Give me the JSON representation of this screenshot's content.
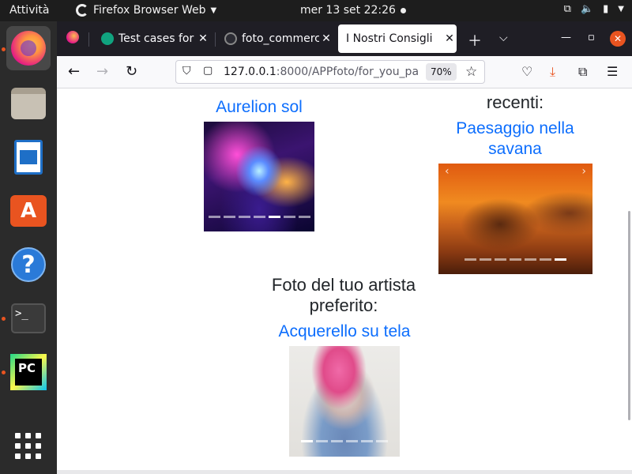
{
  "topbar": {
    "activities": "Attività",
    "app_name": "Firefox Browser Web",
    "clock": "mer 13 set  22:26"
  },
  "dock": {
    "apps": [
      "firefox-icon",
      "files-icon",
      "writer-icon",
      "app-center-icon",
      "help-icon",
      "terminal-icon",
      "pycharm-icon",
      "show-apps-icon"
    ]
  },
  "browser": {
    "tabs": [
      {
        "label": "Test cases for",
        "active": false
      },
      {
        "label": "foto_commerc",
        "active": false
      },
      {
        "label": "I Nostri Consigli",
        "active": true
      }
    ],
    "url_host": "127.0.0.1",
    "url_rest": ":8000/APPfoto/for_you_pa",
    "zoom": "70%"
  },
  "page": {
    "section_recent_heading": "recenti:",
    "section_artist_heading_line1": "Foto del tuo artista",
    "section_artist_heading_line2": "preferito:",
    "photo_1_title": "Aurelion sol",
    "photo_2_title_line1": "Paesaggio nella",
    "photo_2_title_line2": "savana",
    "photo_3_title": "Acquerello su tela",
    "carousel_arrow_prev": "‹",
    "carousel_arrow_next": "›"
  },
  "colors": {
    "link": "#0d6efd",
    "ubuntu_orange": "#e95420",
    "tabbar_bg": "#1f1e25"
  }
}
